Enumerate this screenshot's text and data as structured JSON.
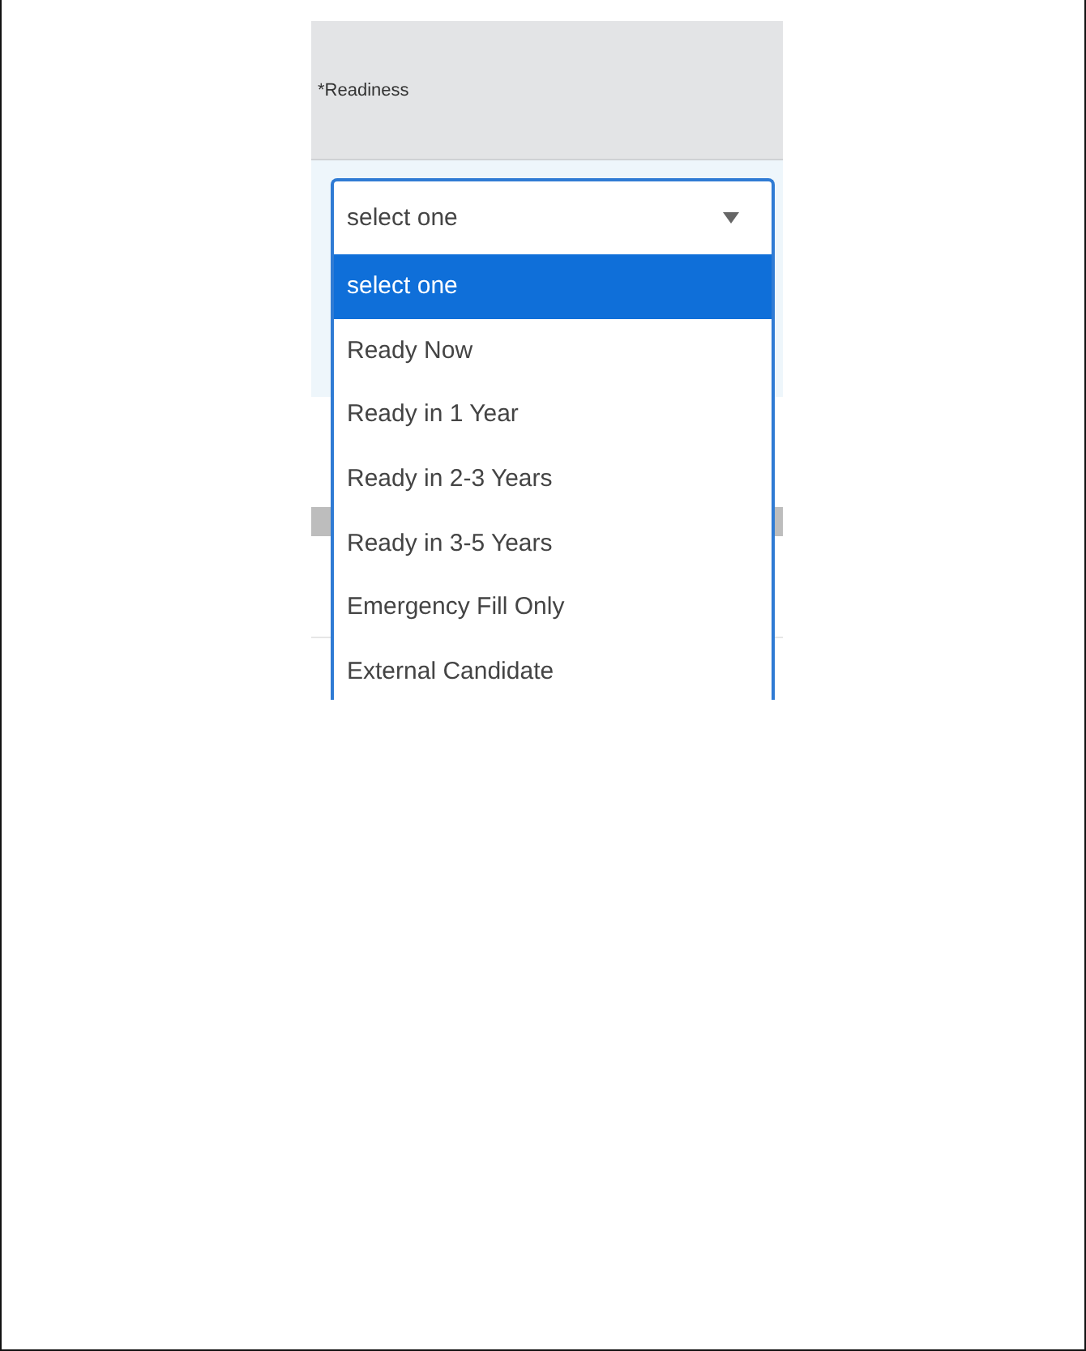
{
  "field": {
    "label": "*Readiness"
  },
  "dropdown": {
    "value": "select one",
    "expanded": true
  },
  "options": [
    {
      "label": "select one",
      "selected": true
    },
    {
      "label": "Ready Now",
      "selected": false
    },
    {
      "label": "Ready in 1 Year",
      "selected": false
    },
    {
      "label": "Ready in 2-3 Years",
      "selected": false
    },
    {
      "label": "Ready in 3-5 Years",
      "selected": false
    },
    {
      "label": "Emergency Fill Only",
      "selected": false
    },
    {
      "label": "External Candidate",
      "selected": false
    }
  ]
}
